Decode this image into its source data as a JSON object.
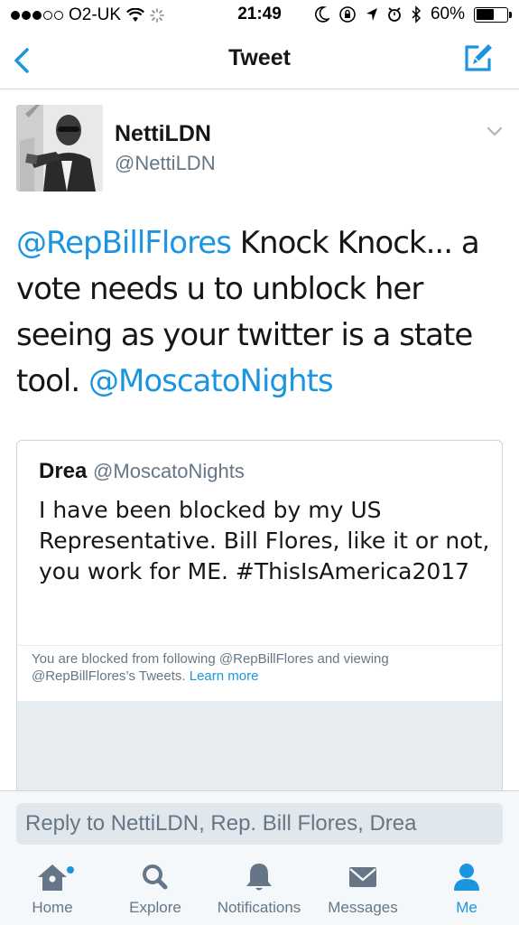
{
  "status_bar": {
    "carrier": "O2-UK",
    "time": "21:49",
    "battery": "60%",
    "battery_level": 0.6
  },
  "nav": {
    "title": "Tweet",
    "back_icon": "chevron-left-icon",
    "compose_icon": "compose-icon"
  },
  "tweet": {
    "display_name": "NettiLDN",
    "handle": "@NettiLDN",
    "text_parts": [
      {
        "text": "@RepBillFlores",
        "type": "mention"
      },
      {
        "text": " Knock Knock... a vote needs u to unblock her seeing as your twitter is a state tool. ",
        "type": "text"
      },
      {
        "text": "@MoscatoNights",
        "type": "mention"
      }
    ]
  },
  "quoted_tweet": {
    "name": "Drea",
    "handle": "@MoscatoNights",
    "text": "I have been blocked by my US Representative. Bill Flores, like it or not, you work for ME. #ThisIsAmerica2017",
    "blocked_notice": "You are blocked from following @RepBillFlores and viewing @RepBillFlores’s Tweets.",
    "learn_more": "Learn more"
  },
  "reply": {
    "placeholder": "Reply to NettiLDN, Rep. Bill Flores, Drea"
  },
  "tabs": [
    {
      "label": "Home",
      "icon": "home-icon",
      "active": false
    },
    {
      "label": "Explore",
      "icon": "search-icon",
      "active": false
    },
    {
      "label": "Notifications",
      "icon": "bell-icon",
      "active": false
    },
    {
      "label": "Messages",
      "icon": "envelope-icon",
      "active": false
    },
    {
      "label": "Me",
      "icon": "person-icon",
      "active": true
    }
  ],
  "colors": {
    "accent": "#1b95e0",
    "text": "#14171a",
    "muted": "#657786",
    "border": "#d0d5d9"
  }
}
